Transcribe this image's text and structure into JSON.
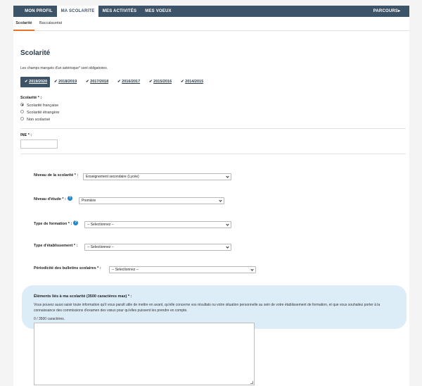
{
  "nav": {
    "tabs": [
      "MON PROFIL",
      "MA SCOLARITE",
      "MES ACTIVITÉS",
      "MES VOEUX"
    ],
    "right": "PARCOURS",
    "right_arrow": "▸"
  },
  "subnav": [
    "Scolarité",
    "Baccalauréat"
  ],
  "page": {
    "title": "Scolarité",
    "hint": "Les champs marqués d'un astérisque* sont obligatoires."
  },
  "years": [
    "2019/2020",
    "2018/2019",
    "2017/2018",
    "2016/2017",
    "2015/2016",
    "2014/2015"
  ],
  "scolarite": {
    "label": "Scolarité * :",
    "options": [
      "Scolarité française",
      "Scolarité étrangère",
      "Non scolarisé"
    ]
  },
  "ine": {
    "label": "INE * :",
    "value": ""
  },
  "fields": {
    "niveau_scolarite": {
      "label": "Niveau de la scolarité * :",
      "value": "Enseignement secondaire (Lycée)"
    },
    "niveau_etude": {
      "label": "Niveau d'étude * :",
      "value": "Première"
    },
    "type_formation": {
      "label": "Type de formation * :",
      "value": "-- Selectionnez --"
    },
    "type_etablissement": {
      "label": "Type d'établissement * :",
      "value": "-- Selectionnez --"
    },
    "periodicite": {
      "label": "Périodicité des bulletins scolaires * :",
      "value": "-- Selectionnez --"
    }
  },
  "elements": {
    "title": "Éléments liés à ma scolarité (3500 caractères max) * :",
    "text": "Vous pouvez aussi saisir toute information qu'il vous paraît utile de mettre en avant, qu'elle concerne vos résultats ou votre situation personnelle au sein de votre établissement de formation, et que vous souhaitez porter à la connaissance des commissions d'examen des vœux pour qu'elles puissent les prendre en compte.",
    "counter": "0 / 3500 caractères."
  },
  "icons": {
    "check": "✔",
    "help": "?"
  }
}
